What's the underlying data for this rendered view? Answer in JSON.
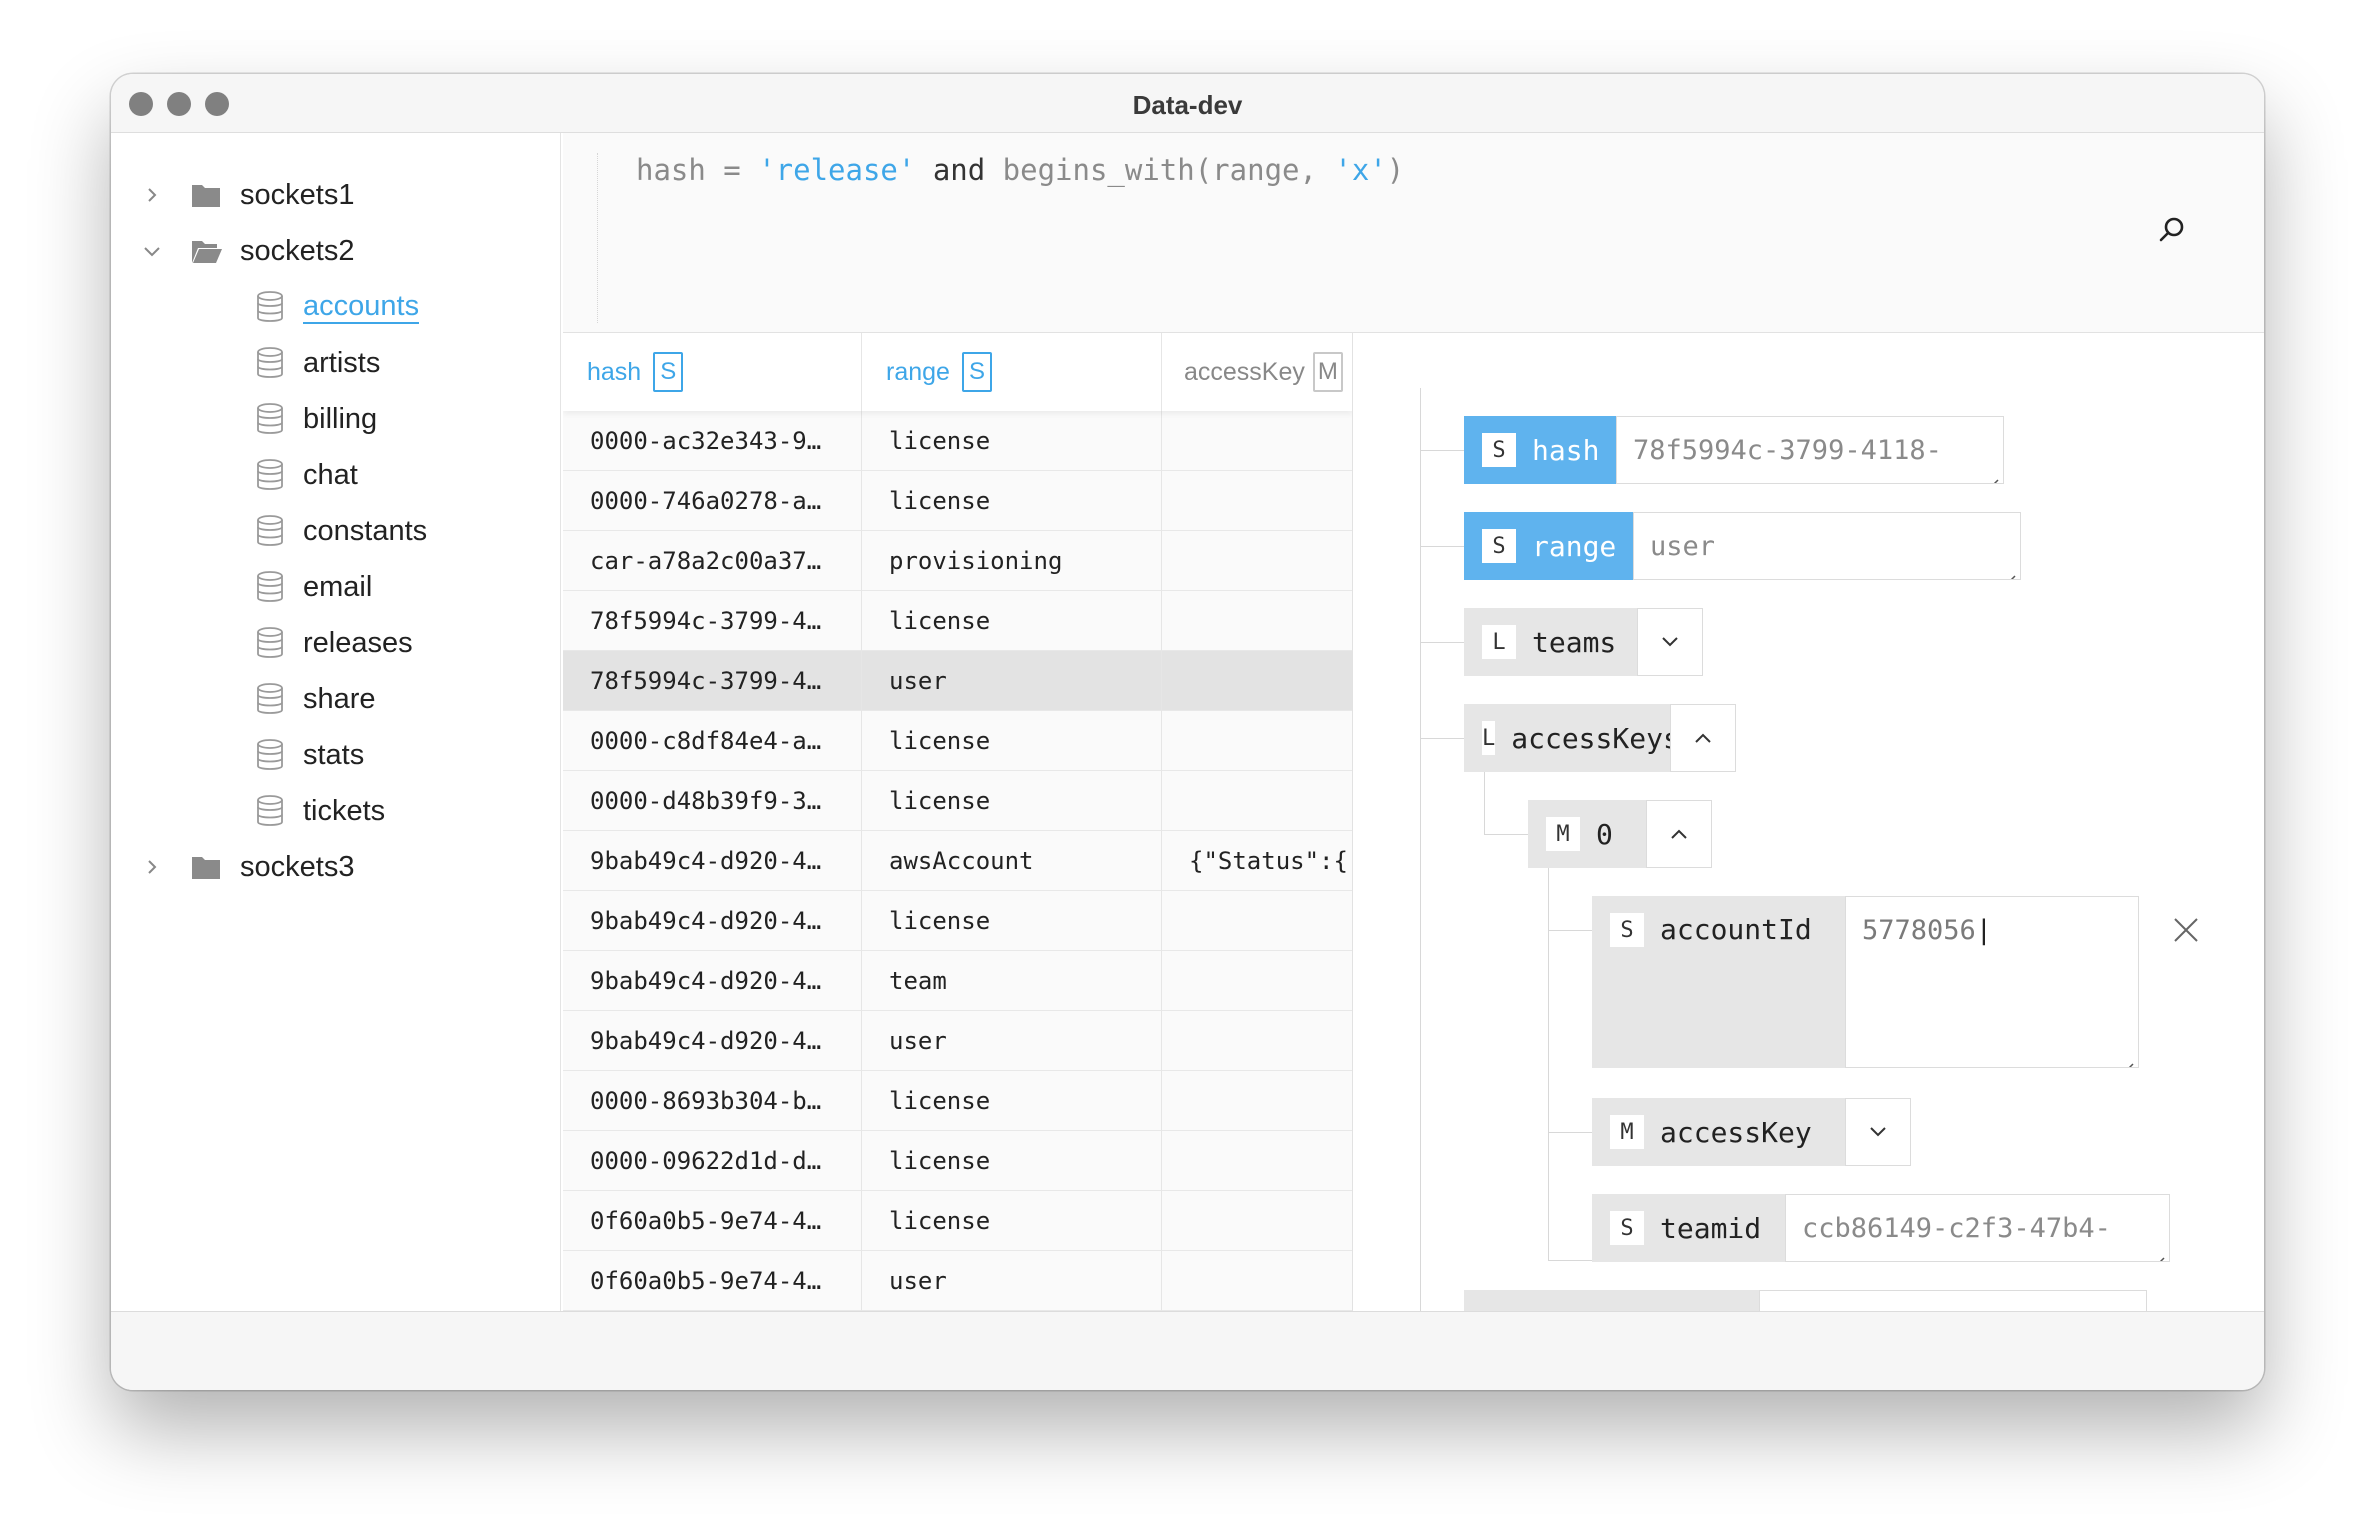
{
  "window": {
    "title": "Data-dev"
  },
  "sidebar": {
    "groups": [
      {
        "label": "sockets1",
        "expanded": false
      },
      {
        "label": "sockets2",
        "expanded": true,
        "tables": [
          "accounts",
          "artists",
          "billing",
          "chat",
          "constants",
          "email",
          "releases",
          "share",
          "stats",
          "tickets"
        ],
        "active": "accounts"
      },
      {
        "label": "sockets3",
        "expanded": false
      }
    ]
  },
  "query": {
    "part1": "hash = ",
    "part2": "'release'",
    "part3": " and ",
    "part4": "begins_with(range, ",
    "part5": "'x'",
    "part6": ")"
  },
  "table": {
    "columns": [
      {
        "name": "hash",
        "type": "S"
      },
      {
        "name": "range",
        "type": "S"
      },
      {
        "name": "accessKey",
        "type": "M"
      }
    ],
    "rows": [
      [
        "0000-ac32e343-9…",
        "license",
        ""
      ],
      [
        "0000-746a0278-a…",
        "license",
        ""
      ],
      [
        "car-a78a2c00a37…",
        "provisioning",
        ""
      ],
      [
        "78f5994c-3799-4…",
        "license",
        ""
      ],
      [
        "78f5994c-3799-4…",
        "user",
        ""
      ],
      [
        "0000-c8df84e4-a…",
        "license",
        ""
      ],
      [
        "0000-d48b39f9-3…",
        "license",
        ""
      ],
      [
        "9bab49c4-d920-4…",
        "awsAccount",
        "{\"Status\":{"
      ],
      [
        "9bab49c4-d920-4…",
        "license",
        ""
      ],
      [
        "9bab49c4-d920-4…",
        "team",
        ""
      ],
      [
        "9bab49c4-d920-4…",
        "user",
        ""
      ],
      [
        "0000-8693b304-b…",
        "license",
        ""
      ],
      [
        "0000-09622d1d-d…",
        "license",
        ""
      ],
      [
        "0f60a0b5-9e74-4…",
        "license",
        ""
      ],
      [
        "0f60a0b5-9e74-4…",
        "user",
        ""
      ]
    ],
    "selected_row": 4
  },
  "detail": {
    "hash": {
      "type": "S",
      "key": "hash",
      "value": "78f5994c-3799-4118-"
    },
    "range": {
      "type": "S",
      "key": "range",
      "value": "user"
    },
    "teams": {
      "type": "L",
      "key": "teams"
    },
    "accessKeys": {
      "type": "L",
      "key": "accessKeys"
    },
    "item0": {
      "type": "M",
      "key": "0"
    },
    "accountId": {
      "type": "S",
      "key": "accountId",
      "value": "5778056"
    },
    "accessKey": {
      "type": "M",
      "key": "accessKey"
    },
    "teamid": {
      "type": "S",
      "key": "teamid",
      "value": "ccb86149-c2f3-47b4-"
    }
  }
}
